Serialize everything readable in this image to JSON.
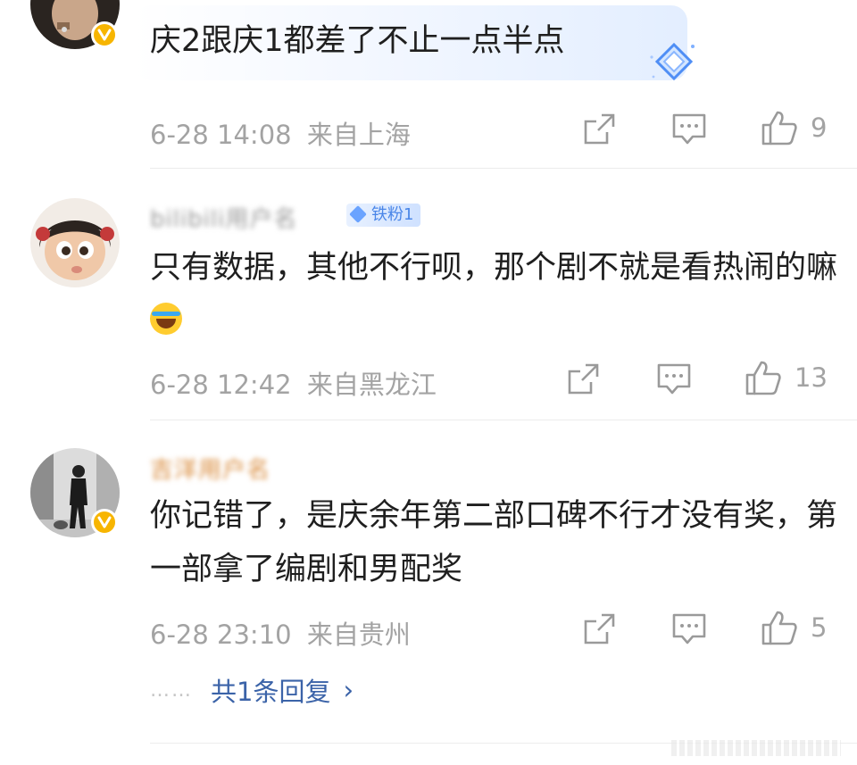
{
  "comments": [
    {
      "username": "",
      "text": "庆2跟庆1都差了不止一点半点",
      "time": "6-28 14:08",
      "location": "来自上海",
      "likes": "9",
      "verified": true
    },
    {
      "username": "bilibili用户名",
      "fan_badge": "铁粉1",
      "text": "只有数据，其他不行呗，那个剧不就是看热闹的嘛",
      "time": "6-28 12:42",
      "location": "来自黑龙江",
      "likes": "13",
      "verified": false
    },
    {
      "username": "吉洋用户名",
      "text": "你记错了，是庆余年第二部口碑不行才没有奖，第一部拿了编剧和男配奖",
      "time": "6-28 23:10",
      "location": "来自贵州",
      "likes": "5",
      "verified": true
    }
  ],
  "replies": {
    "dots": "……",
    "label": "共1条回复",
    "chevron": "›"
  },
  "icons": {
    "share": "share-icon",
    "comment": "comment-icon",
    "like": "like-icon",
    "verified": "verified-v-icon",
    "diamond": "diamond-icon"
  },
  "colors": {
    "meta": "#a3a3a3",
    "link": "#3b63a8",
    "verified": "#f7b500",
    "fan_badge": "#4a86e8"
  }
}
